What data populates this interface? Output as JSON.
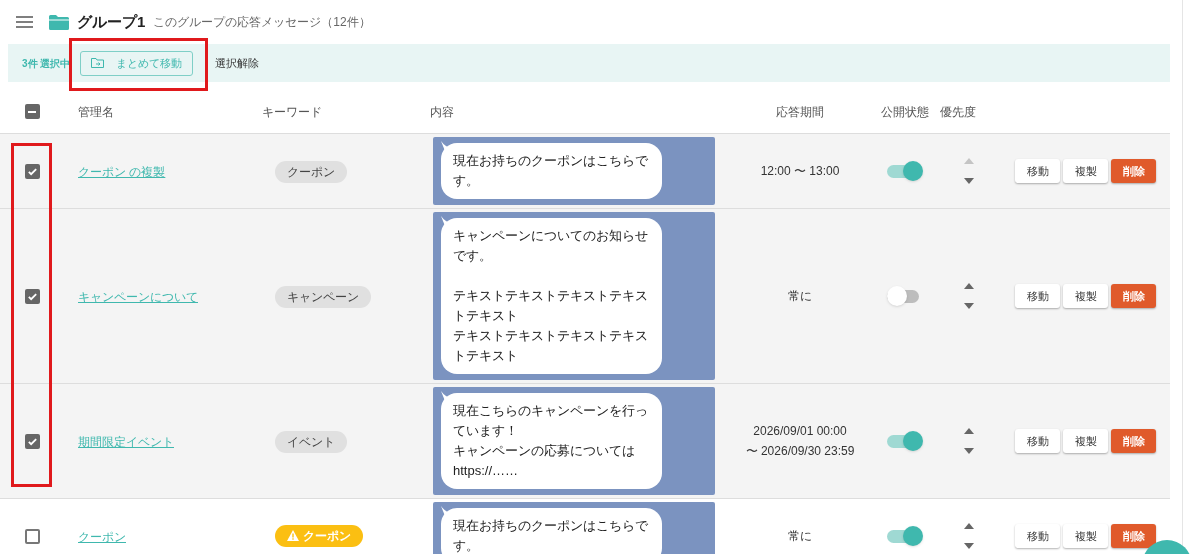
{
  "header": {
    "title": "グループ1",
    "subtitle": "このグループの応答メッセージ（12件）"
  },
  "selection_bar": {
    "count": "3件 選択中",
    "move_button": "まとめて移動",
    "clear_button": "選択解除"
  },
  "table": {
    "select_all": {
      "indeterminate": true
    },
    "columns": [
      "管理名",
      "キーワード",
      "内容",
      "応答期間",
      "公開状態",
      "優先度"
    ],
    "rows": [
      {
        "checked": true,
        "name": "クーポン の複製",
        "keyword": {
          "kind": "normal",
          "label": "クーポン"
        },
        "content": [
          [
            "現在お持ちのクーポンはこちらです。"
          ]
        ],
        "period": "12:00 〜 13:00",
        "published": true,
        "up_enabled": false,
        "down_enabled": true,
        "actions": [
          "移動",
          "複製",
          "削除"
        ]
      },
      {
        "checked": true,
        "name": "キャンペーンについて",
        "keyword": {
          "kind": "normal",
          "label": "キャンペーン"
        },
        "content": [
          [
            "キャンペーンについてのお知らせです。"
          ],
          [
            "テキストテキストテキストテキストテキスト",
            "テキストテキストテキストテキストテキスト"
          ]
        ],
        "period": "常に",
        "published": false,
        "up_enabled": true,
        "down_enabled": true,
        "actions": [
          "移動",
          "複製",
          "削除"
        ]
      },
      {
        "checked": true,
        "name": "期間限定イベント",
        "keyword": {
          "kind": "normal",
          "label": "イベント"
        },
        "content": [
          [
            "現在こちらのキャンペーンを行っています！",
            "キャンペーンの応募については",
            "https://……"
          ]
        ],
        "period": "2026/09/01 00:00\n〜 2026/09/30 23:59",
        "published": true,
        "up_enabled": true,
        "down_enabled": true,
        "actions": [
          "移動",
          "複製",
          "削除"
        ]
      },
      {
        "checked": false,
        "name": "クーポン",
        "keyword": {
          "kind": "warning",
          "label": "クーポン"
        },
        "content": [
          [
            "現在お持ちのクーポンはこちらです。"
          ]
        ],
        "period": "常に",
        "published": true,
        "up_enabled": true,
        "down_enabled": true,
        "actions": [
          "移動",
          "複製",
          "削除"
        ]
      }
    ]
  }
}
